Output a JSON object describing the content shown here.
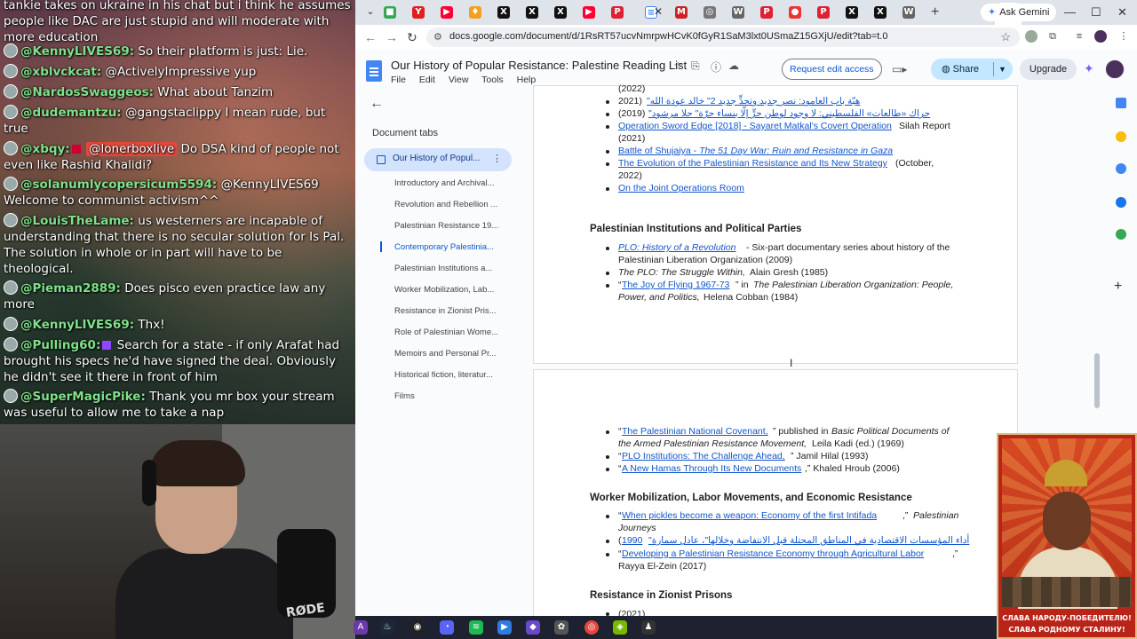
{
  "chat": {
    "lines": [
      {
        "user": "",
        "text": "tankie takes on ukraine in his chat but i think he assumes people like DAC are just stupid and will moderate with more education"
      },
      {
        "user": "@KennyLIVES69:",
        "text": "So their platform is just: Lie."
      },
      {
        "user": "@xblvckcat:",
        "text": "@ActivelyImpressive yup"
      },
      {
        "user": "@NardosSwaggeos:",
        "text": "What about Tanzim"
      },
      {
        "user": "@dudemantzu:",
        "text": "@gangstaclippy I mean rude, but true"
      },
      {
        "user": "@xbqy:",
        "mention": "@lonerboxlive",
        "text": "Do DSA kind of people not even like Rashid Khalidi?"
      },
      {
        "user": "@solanumlycopersicum5594:",
        "text": "@KennyLIVES69 Welcome to communist activism^^"
      },
      {
        "user": "@LouisTheLame:",
        "text": "us westerners are incapable of understanding that there is no secular solution for Is Pal. The solution in whole or in part will have to be theological."
      },
      {
        "user": "@Pieman2889:",
        "text": "Does pisco even practice law any more"
      },
      {
        "user": "@KennyLIVES69:",
        "text": "Thx!"
      },
      {
        "user": "@Pulling60:",
        "text": "Search for a state - if only Arafat had brought his specs he'd have signed the deal. Obviously he didn't see it there in front of him"
      },
      {
        "user": "@SuperMagicPike:",
        "text": "Thank you mr box your stream was useful to allow me to take a nap"
      }
    ],
    "mic_label": "RØDE"
  },
  "browser": {
    "gemini_label": "Ask Gemini",
    "url": "docs.google.com/document/d/1RsRT57ucvNmrpwHCvK0fGyR1SaM3lxt0USmaZ15GXjU/edit?tab=t.0",
    "icons": [
      "back-icon",
      "forward-icon",
      "reload-icon",
      "star-icon",
      "extensions-icon"
    ]
  },
  "docs": {
    "title": "Our History of Popular Resistance: Palestine Reading List",
    "menu": [
      "File",
      "Edit",
      "View",
      "Tools",
      "Help"
    ],
    "request_edit": "Request edit access",
    "share": "Share",
    "upgrade": "Upgrade",
    "tabs_heading": "Document tabs",
    "main_tab": "Our History of Popul...",
    "subtabs": [
      "Introductory and Archival...",
      "Revolution and Rebellion ...",
      "Palestinian Resistance 19...",
      "Contemporary Palestinia...",
      "Palestinian Institutions a...",
      "Worker Mobilization, Lab...",
      "Resistance in Zionist Pris...",
      "Role of Palestinian Wome...",
      "Memoirs and Personal Pr...",
      "Historical fiction, literatur...",
      "Films"
    ]
  },
  "content": {
    "p1": {
      "l0": "(2022)",
      "l1_year": "2021)",
      "l1_ar": "\"هبّة باب العامود: نصر جديد وتحدٍّ جديد 2\" خالد عودة الله",
      "l2_year": "(2019)",
      "l2_ar": "\"حراك «طالعات» الفلسطيني: لا وجود لوطن حرٍّ إلّا بنساء حرّة\" حلا مرشود",
      "l3_link": "Operation Sword Edge [2018] - Sayaret Matkal's Covert Operation",
      "l3_rest": "Silah Report",
      "l3b": "(2021)",
      "l4_link_a": "Battle of Shujaiya - ",
      "l4_link_b": "The 51 Day War: Ruin and Resistance in Gaza",
      "l5_link": "The Evolution of the Palestinian Resistance and Its New Strategy",
      "l5_rest": "(October,",
      "l5b": "2022)",
      "l6_link": "On the Joint Operations Room",
      "h_institutions": "Palestinian Institutions and Political Parties",
      "i1_link": "PLO: History of a Revolution",
      "i1_rest": "- Six-part documentary series about history of the",
      "i1b": "Palestinian Liberation Organization (2009)",
      "i2_ital": "The PLO: The Struggle Within,",
      "i2_rest": "Alain Gresh (1985)",
      "i3_q": "“",
      "i3_link": "The Joy of Flying 1967-73",
      "i3_mid": "” in",
      "i3_ital": "The Palestinian Liberation Organization: People,",
      "i3b_ital": "Power, and Politics,",
      "i3b_rest": "Helena Cobban (1984)"
    },
    "p2": {
      "c1_link": "The Palestinian National Covenant,",
      "c1_rest": "” published in",
      "c1_ital": "Basic Political Documents of",
      "c1b_ital": "the Armed Palestinian Resistance Movement,",
      "c1b_rest": "Leila Kadi (ed.) (1969)",
      "c2_link": "PLO Institutions: The Challenge Ahead,",
      "c2_rest": "” Jamil Hilal (1993)",
      "c3_link": "A New Hamas Through Its New Documents",
      "c3_rest": ",” Khaled Hroub (2006)",
      "h_worker": "Worker Mobilization, Labor Movements, and Economic Resistance",
      "w1_link": "When pickles become a weapon: Economy of the first Intifada",
      "w1_rest": ",”",
      "w1_ital": "Palestinian",
      "w1b_ital": "Journeys",
      "w2_year": "1990",
      "w2_ar": "\"أداء المؤسسات الاقتصادية في المناطق المحتلة قبل الانتفاضة وخلالها\"، عادل سمارة",
      "w3_link": "Developing a Palestinian Resistance Economy through Agricultural Labor",
      "w3_rest": ",”",
      "w3b": "Rayya El-Zein (2017)",
      "h_prisons": "Resistance in Zionist Prisons",
      "pr1": "(2021)"
    }
  },
  "poster": {
    "caption_1": "СЛАВА НАРОДУ-ПОБЕДИТЕЛЮ!",
    "caption_2": "СЛАВА РОДНОМУ СТАЛИНУ!"
  },
  "colors": {
    "link": "#1155cc",
    "share_bg": "#c2e7ff",
    "active_tab_bg": "#d3e3fd",
    "chat_user": "#7fe08a"
  }
}
